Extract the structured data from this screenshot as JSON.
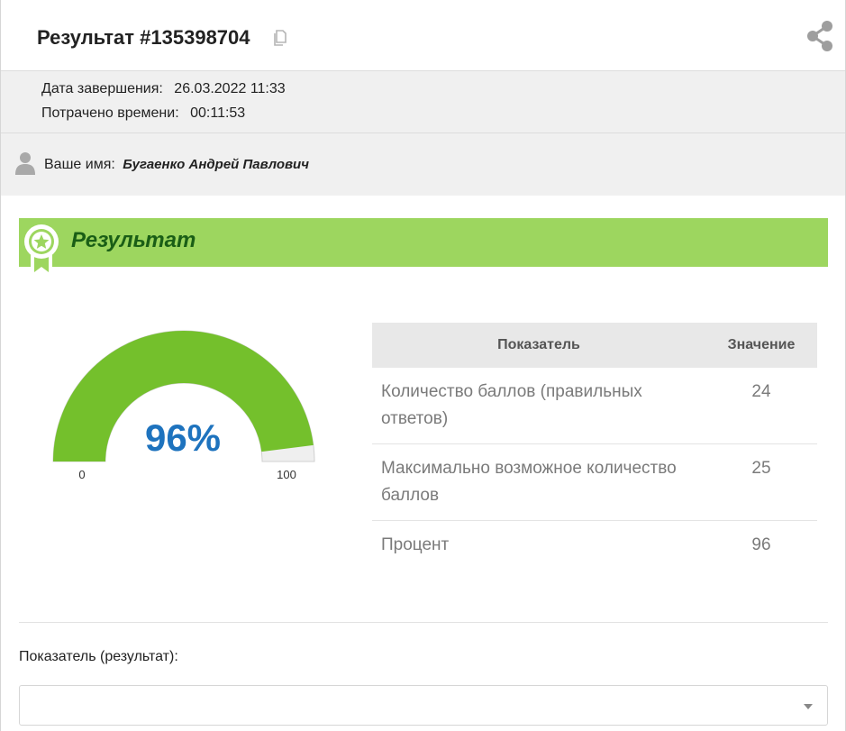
{
  "header": {
    "title": "Результат #135398704",
    "copy_icon": "copy-icon",
    "share_icon": "share-icon"
  },
  "meta": {
    "completed_label": "Дата завершения:",
    "completed_value": "26.03.2022 11:33",
    "spent_label": "Потрачено времени:",
    "spent_value": "00:11:53"
  },
  "user": {
    "icon": "user-icon",
    "label": "Ваше имя:",
    "name": "Бугаенко Андрей Павлович"
  },
  "result_section": {
    "title": "Результат",
    "badge_icon": "award-badge-icon",
    "bar_color": "#9dd65f"
  },
  "gauge": {
    "percent_text": "96%",
    "value": 96,
    "min": 0,
    "max": 100,
    "min_label": "0",
    "max_label": "100",
    "fill_color": "#74c02c",
    "track_color": "#efefef",
    "text_color": "#1e73be"
  },
  "stats_table": {
    "headers": [
      "Показатель",
      "Значение"
    ],
    "rows": [
      {
        "name": "Количество баллов (правильных ответов)",
        "value": "24"
      },
      {
        "name": "Максимально возможное количество баллов",
        "value": "25"
      },
      {
        "name": "Процент",
        "value": "96"
      }
    ]
  },
  "filter": {
    "label": "Показатель (результат):",
    "selected": ""
  }
}
